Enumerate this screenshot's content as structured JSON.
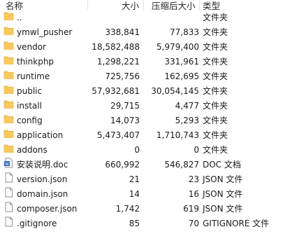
{
  "columns": {
    "name": "名称",
    "size": "大小",
    "compressed": "压缩后大小",
    "type": "类型"
  },
  "rows": [
    {
      "name": "..",
      "size": "",
      "compressed": "",
      "type": "文件夹",
      "icon": "folder-icon"
    },
    {
      "name": "ymwl_pusher",
      "size": "338,841",
      "compressed": "77,833",
      "type": "文件夹",
      "icon": "folder-icon"
    },
    {
      "name": "vendor",
      "size": "18,582,488",
      "compressed": "5,979,400",
      "type": "文件夹",
      "icon": "folder-icon"
    },
    {
      "name": "thinkphp",
      "size": "1,298,221",
      "compressed": "331,961",
      "type": "文件夹",
      "icon": "folder-icon"
    },
    {
      "name": "runtime",
      "size": "725,756",
      "compressed": "162,695",
      "type": "文件夹",
      "icon": "folder-icon"
    },
    {
      "name": "public",
      "size": "57,932,681",
      "compressed": "30,054,145",
      "type": "文件夹",
      "icon": "folder-icon"
    },
    {
      "name": "install",
      "size": "29,715",
      "compressed": "4,477",
      "type": "文件夹",
      "icon": "folder-icon"
    },
    {
      "name": "config",
      "size": "14,073",
      "compressed": "5,293",
      "type": "文件夹",
      "icon": "folder-icon"
    },
    {
      "name": "application",
      "size": "5,473,407",
      "compressed": "1,710,743",
      "type": "文件夹",
      "icon": "folder-icon"
    },
    {
      "name": "addons",
      "size": "0",
      "compressed": "0",
      "type": "文件夹",
      "icon": "folder-icon"
    },
    {
      "name": "安装说明.doc",
      "size": "660,992",
      "compressed": "546,827",
      "type": "DOC 文档",
      "icon": "word-doc-icon"
    },
    {
      "name": "version.json",
      "size": "21",
      "compressed": "23",
      "type": "JSON 文件",
      "icon": "file-icon"
    },
    {
      "name": "domain.json",
      "size": "14",
      "compressed": "16",
      "type": "JSON 文件",
      "icon": "file-icon"
    },
    {
      "name": "composer.json",
      "size": "1,742",
      "compressed": "619",
      "type": "JSON 文件",
      "icon": "file-icon"
    },
    {
      "name": ".gitignore",
      "size": "85",
      "compressed": "70",
      "type": "GITIGNORE 文件",
      "icon": "file-icon"
    }
  ],
  "colors": {
    "folder": "#f8c95c",
    "folder_tab": "#e6a930",
    "file_border": "#8a8a8a",
    "doc_blue": "#2b5fb3"
  }
}
